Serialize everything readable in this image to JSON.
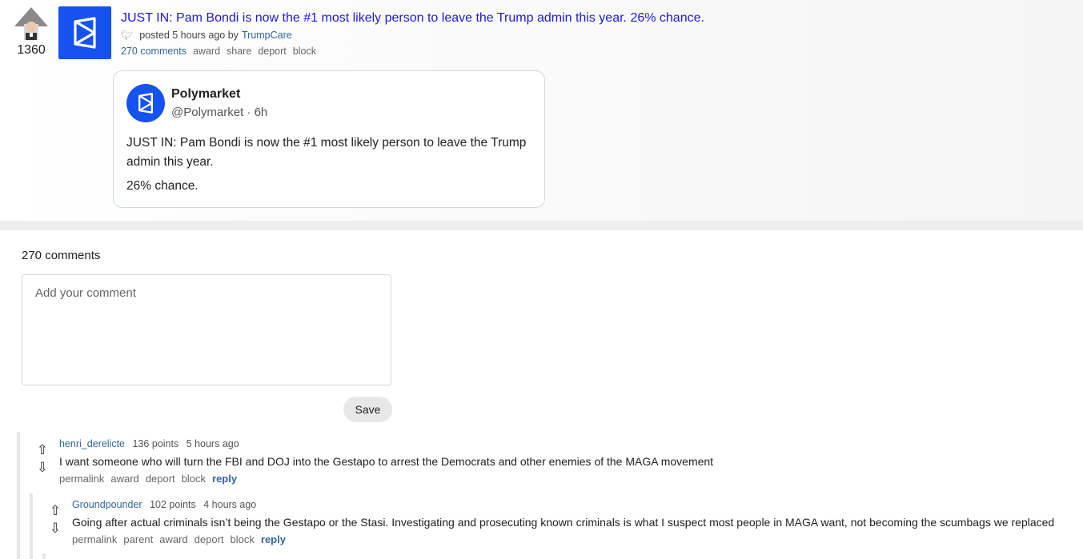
{
  "post": {
    "score": "1360",
    "title": "JUST IN: Pam Bondi is now the #1 most likely person to leave the Trump admin this year. 26% chance.",
    "posted": "posted 5 hours ago by",
    "author": "TrumpCare",
    "actions": {
      "comments": "270 comments",
      "award": "award",
      "share": "share",
      "deport": "deport",
      "block": "block"
    },
    "embed": {
      "name": "Polymarket",
      "handle": "@Polymarket · 6h",
      "text_1": "JUST IN: Pam Bondi is now the #1 most likely person to leave the Trump admin this year.",
      "text_2": "26% chance."
    },
    "accent_color": "#1652f0"
  },
  "comments_section": {
    "count": "270 comments",
    "input_placeholder": "Add your comment",
    "save_label": "Save"
  },
  "comments": [
    {
      "user": "henri_derelicte",
      "points": "136 points",
      "time": "5 hours ago",
      "text": "I want someone who will turn the FBI and DOJ into the Gestapo to arrest the Democrats and other enemies of the MAGA movement",
      "links": [
        "permalink",
        "award",
        "deport",
        "block",
        "reply"
      ]
    },
    {
      "user": "Groundpounder",
      "points": "102 points",
      "time": "4 hours ago",
      "text": "Going after actual criminals isn’t being the Gestapo or the Stasi. Investigating and prosecuting known criminals is what I suspect most people in MAGA want, not becoming the scumbags we replaced",
      "links": [
        "permalink",
        "parent",
        "award",
        "deport",
        "block",
        "reply"
      ]
    }
  ],
  "icons": {
    "upvote": "arrow-up-outline-icon",
    "downvote": "arrow-down-outline-icon",
    "twitter": "twitter-bird-icon",
    "logo": "polymarket-logo-icon"
  }
}
